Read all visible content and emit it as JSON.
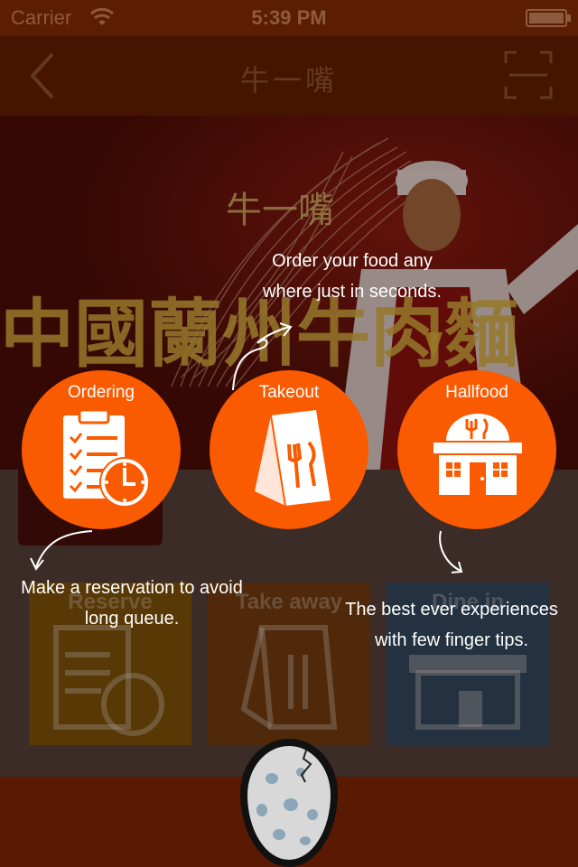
{
  "status_bar": {
    "carrier": "Carrier",
    "time": "5:39 PM"
  },
  "nav": {
    "title": "牛一嘴",
    "back_icon": "chevron-left-icon",
    "scan_icon": "scan-icon"
  },
  "hero": {
    "banner_text": "中國蘭州牛肉麵",
    "sign_text": "牛一嘴"
  },
  "features": [
    {
      "label": "Ordering",
      "icon": "clipboard-clock-icon"
    },
    {
      "label": "Takeout",
      "icon": "takeout-bag-icon"
    },
    {
      "label": "Hallfood",
      "icon": "restaurant-icon"
    }
  ],
  "tiles": [
    {
      "label": "Reserve",
      "icon": "clipboard-clock-icon",
      "color": "#f2b300"
    },
    {
      "label": "Take away",
      "icon": "takeout-bag-icon",
      "color": "#e07a10"
    },
    {
      "label": "Dine in",
      "icon": "restaurant-icon",
      "color": "#2a8ad0"
    }
  ],
  "tips": {
    "order": [
      "Order your food any",
      "where just in seconds."
    ],
    "reserve": [
      "Make a reservation to avoid",
      "long queue."
    ],
    "best": [
      "The best ever experiences",
      "with few finger tips."
    ]
  },
  "colors": {
    "accent": "#fa5a00",
    "nav_bg": "#5c1e02",
    "bottom_bar": "#5a1a02"
  }
}
